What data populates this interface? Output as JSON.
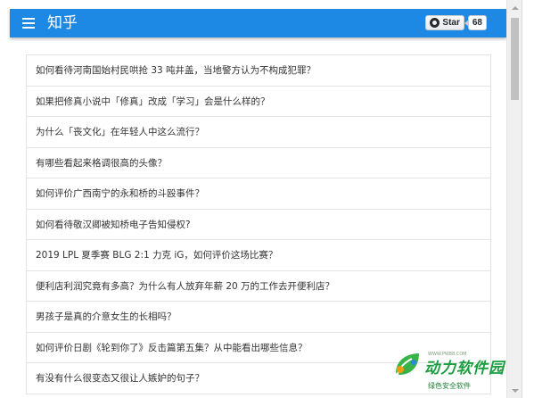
{
  "app": {
    "title": "知乎",
    "theme_color": "#1e88e5"
  },
  "github_star": {
    "label": "Star",
    "count": "68",
    "icon": "github-icon"
  },
  "questions": [
    "如何看待河南国始村民哄抢 33 吨井盖，当地警方认为不构成犯罪？",
    "如果把修真小说中「修真」改成「学习」会是什么样的？",
    "为什么「丧文化」在年轻人中这么流行？",
    "有哪些看起来格调很高的头像？",
    "如何评价广西南宁的永和桥的斗殴事件？",
    "如何看待敬汉卿被知桥电子告知侵权?",
    "2019 LPL 夏季赛 BLG 2:1 力克 iG，如何评价这场比赛？",
    "便利店利润究竟有多高？为什么有人放弃年薪 20 万的工作去开便利店？",
    "男孩子是真的介意女生的长相吗？",
    "如何评价日剧《轮到你了》反击篇第五集？从中能看出哪些信息？",
    "有没有什么很变态又很让人嫉妒的句子？"
  ],
  "watermark": {
    "title": "动力软件园",
    "subtitle": "绿色安全软件",
    "url": "WWW.PW88.COM"
  }
}
